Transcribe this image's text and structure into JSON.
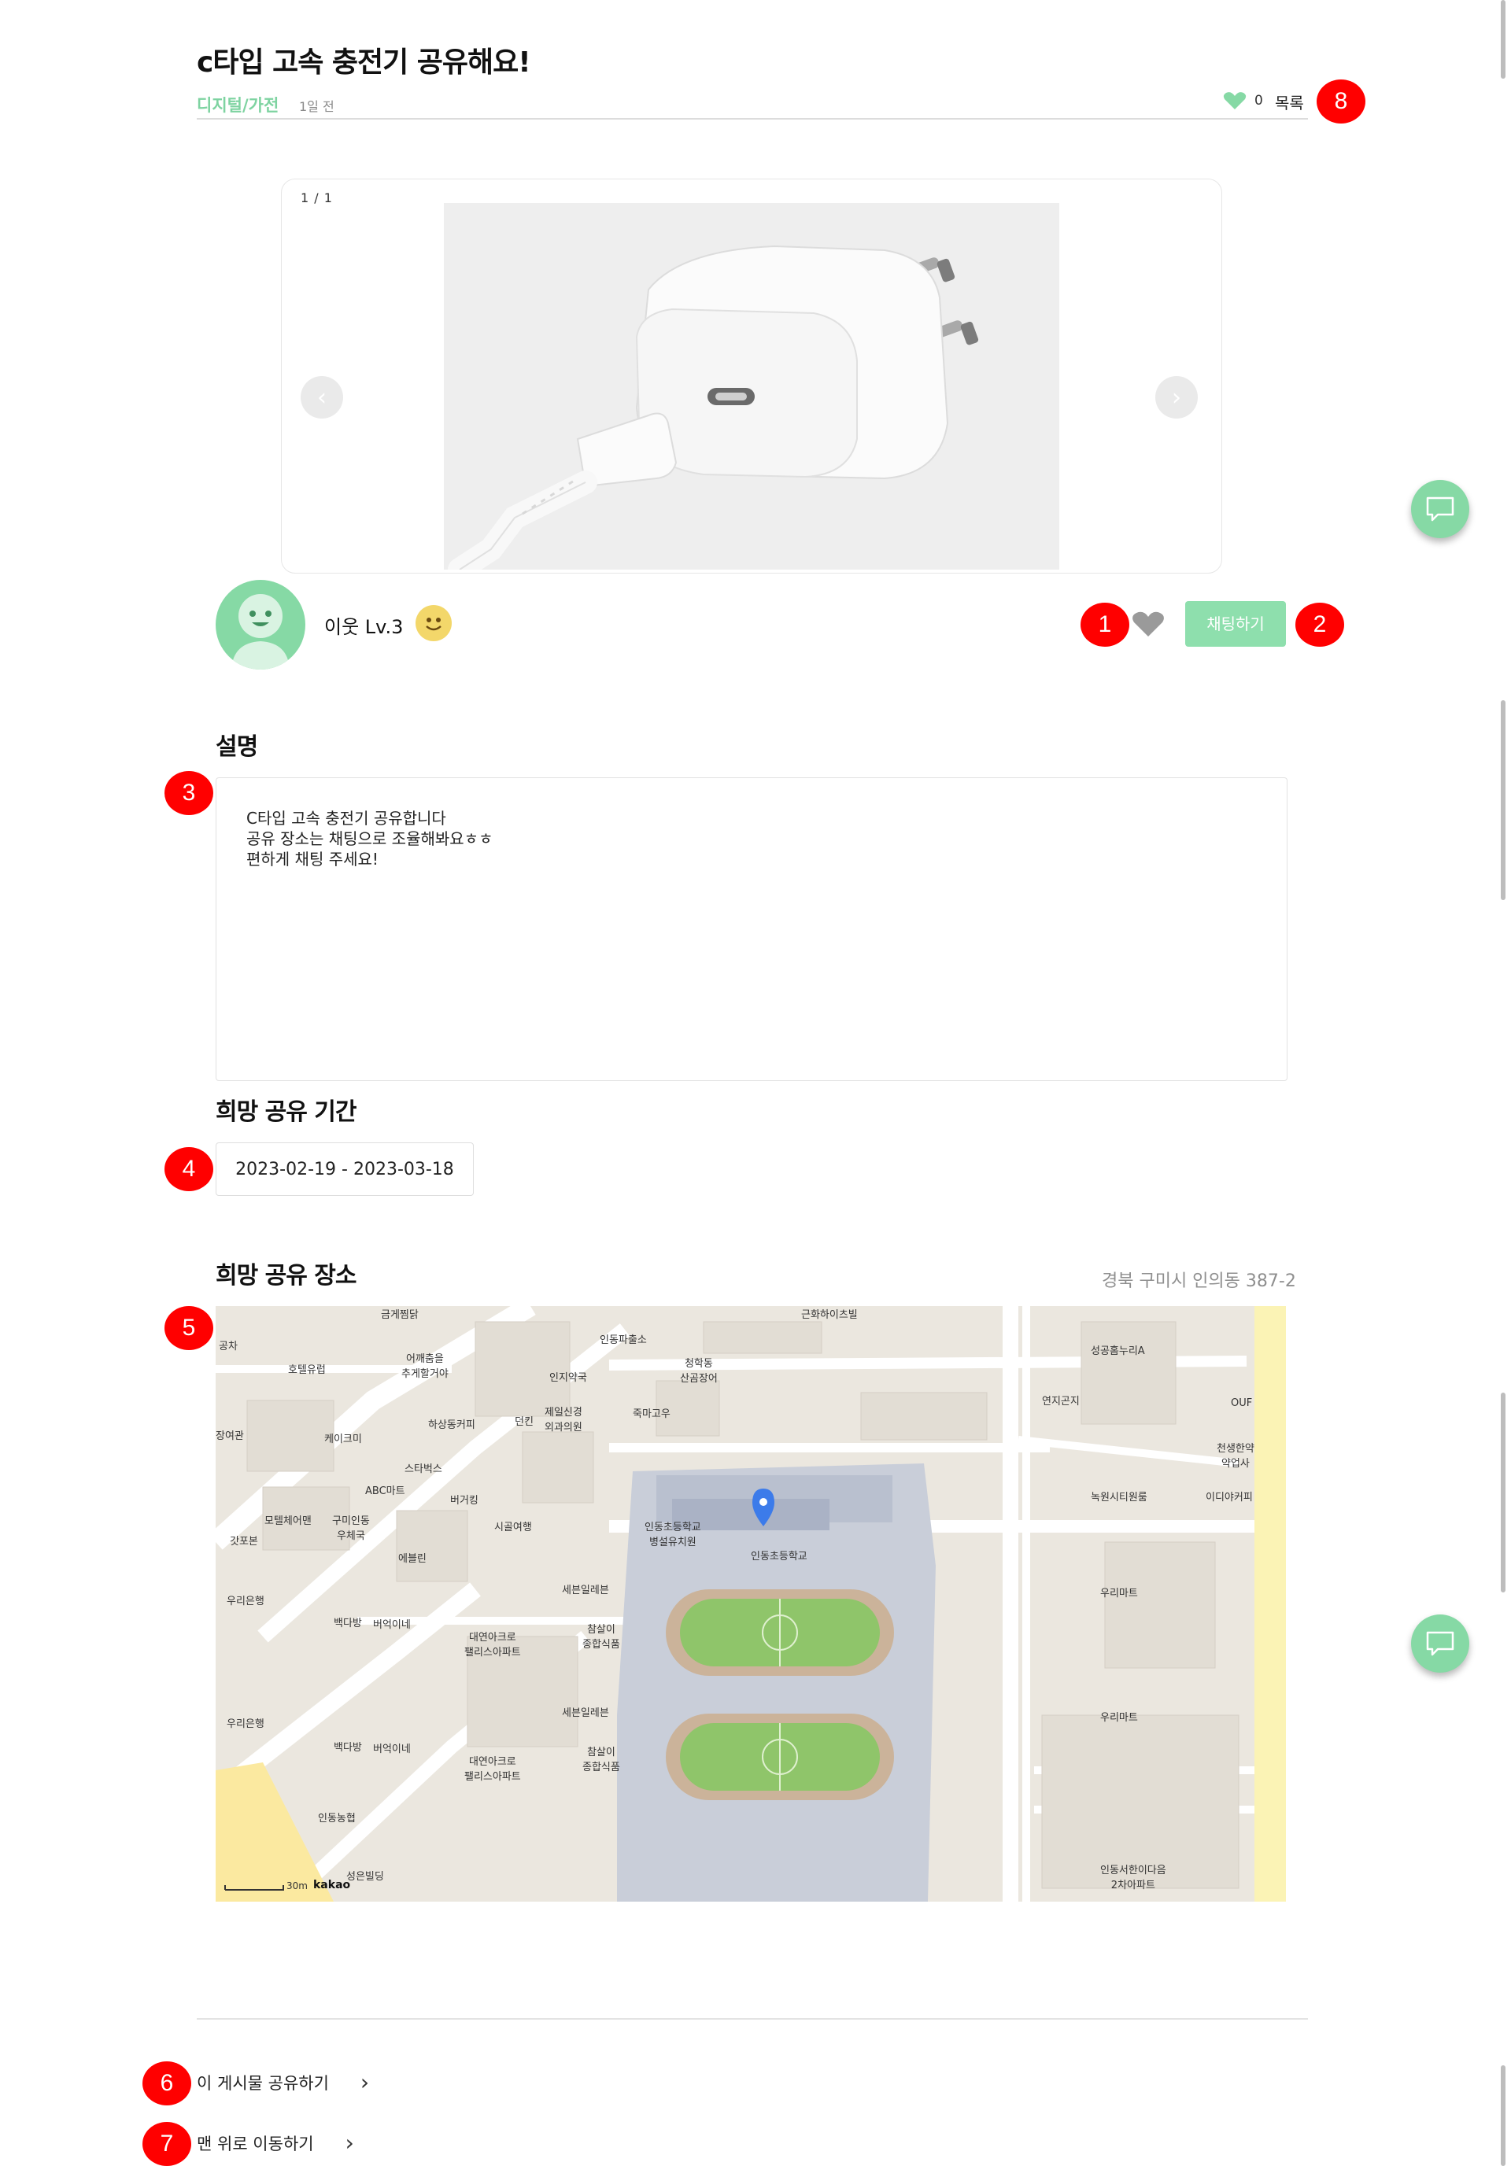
{
  "post": {
    "title": "c타입 고속 충전기 공유해요!",
    "category": "디지털/가전",
    "time_ago": "1일 전",
    "like_count": "0",
    "list_label": "목록"
  },
  "gallery": {
    "counter": "1 / 1",
    "prev_icon": "chevron-left-icon",
    "next_icon": "chevron-right-icon"
  },
  "seller": {
    "nickname": "이웃  Lv.3",
    "chat_button": "채팅하기"
  },
  "description": {
    "heading": "설명",
    "text": "C타입 고속 충전기 공유합니다\n공유 장소는 채팅으로 조율해봐요ㅎㅎ\n편하게 채팅 주세요!"
  },
  "period": {
    "heading": "희망 공유 기간",
    "range": "2023-02-19 - 2023-03-18"
  },
  "place": {
    "heading": "희망 공유 장소",
    "address": "경북 구미시 인의동 387-2",
    "map_labels": {
      "school": "인동초등학교",
      "school_annex": "인동초등학교\n병설유치원",
      "mart": "우리마트",
      "mart2": "우리마트",
      "police": "인동파출소",
      "bank": "우리은행",
      "bank2": "우리은행",
      "abc": "ABC마트",
      "post": "구미인동\n우체국",
      "motel": "모텔체어맨",
      "hotel": "호텔유럽",
      "starbucks": "스타벅스",
      "pharmacy": "인지약국",
      "clinic": "제일신경\n외과의원",
      "seven": "세븐일레븐",
      "seven2": "세븐일레븐",
      "trade": "대연아크로\n팰리스아파트",
      "trade2": "대연아크로\n팰리스아파트",
      "kakao": "kakao",
      "scale": "30m",
      "chamsari": "참살이\n종합식품",
      "chamsari2": "참살이\n종합식품",
      "sigol": "시골여행",
      "burger": "버거킹",
      "cake": "케이크미",
      "ebullet": "에블린",
      "geungeum": "금게찜닭",
      "bakery": "백다방",
      "bakery2": "백다방",
      "burgerine": "버억이네",
      "burgerine2": "버억이네",
      "nokwon": "녹원시티원룸",
      "idia": "이디야커피",
      "cheonsaeng": "천생한약\n약업사",
      "seonggong": "성공홈누리A",
      "yeonji": "연지곤지",
      "cheonghak": "청학동\n산곰장어",
      "jukma": "죽마고우",
      "dunkin": "던킨",
      "hasang": "하상동커피",
      "ouf": "OUF",
      "inhyeop": "인동농협",
      "seongeun": "성은빌딩",
      "apt2": "인동서한이다음\n2차아파트",
      "geunhwa": "근화하이츠빌",
      "gappo": "갓포본",
      "gongcha": "공차",
      "janggu": "장여관",
      "eokkae": "어깨춤을\n추게할거야"
    }
  },
  "footer": {
    "share": "이 게시물 공유하기",
    "to_top": "맨 위로 이동하기"
  },
  "markers": [
    "1",
    "2",
    "3",
    "4",
    "5",
    "6",
    "7",
    "8"
  ],
  "colors": {
    "accent": "#86d9a5",
    "marker": "#ff0000",
    "category": "#7ed3a1"
  }
}
